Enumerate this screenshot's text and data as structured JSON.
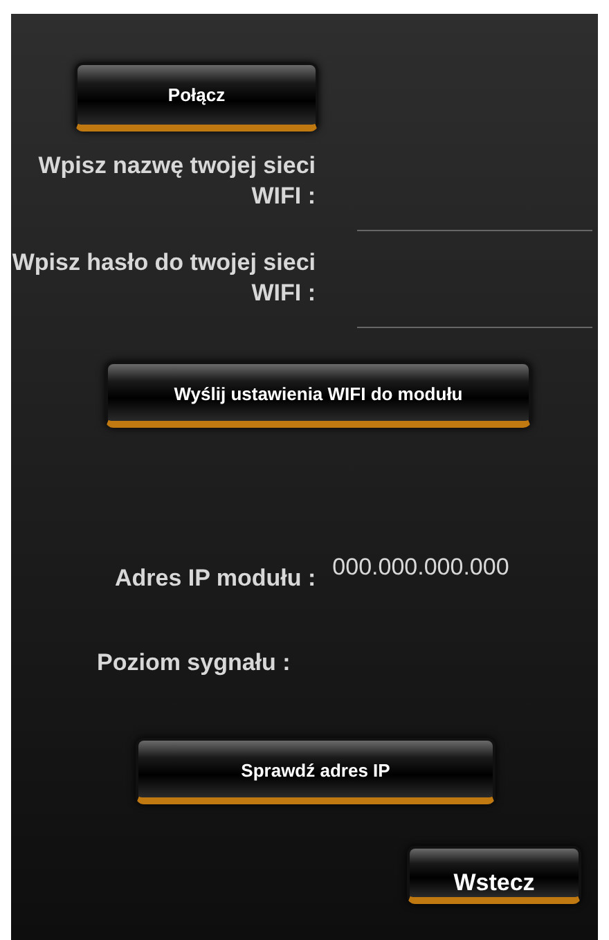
{
  "connect_button": "Połącz",
  "fields": [
    {
      "label": "Wpisz nazwę twojej sieci WIFI :"
    },
    {
      "label": "Wpisz hasło do twojej sieci WIFI :"
    }
  ],
  "send_button": "Wyślij ustawienia WIFI do modułu",
  "ip_label": "Adres IP modułu :",
  "ip_value": "000.000.000.000",
  "signal_label": "Poziom sygnału :",
  "check_ip_button": "Sprawdź adres IP",
  "back_button": "Wstecz"
}
